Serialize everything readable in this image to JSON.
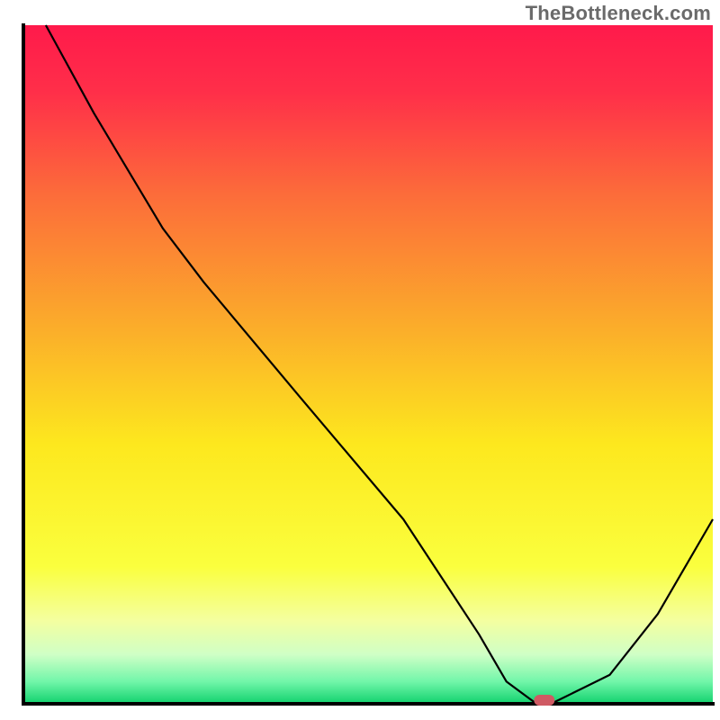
{
  "watermark": "TheBottleneck.com",
  "chart_data": {
    "type": "line",
    "title": "",
    "xlabel": "",
    "ylabel": "",
    "xlim": [
      0,
      100
    ],
    "ylim": [
      0,
      100
    ],
    "series": [
      {
        "name": "bottleneck-curve",
        "x": [
          3,
          10,
          20,
          26,
          40,
          55,
          66,
          70,
          74,
          77,
          85,
          92,
          100
        ],
        "y": [
          100,
          87,
          70,
          62,
          45,
          27,
          10,
          3,
          0,
          0,
          4,
          13,
          27
        ]
      }
    ],
    "marker": {
      "name": "optimal-range",
      "x_start": 74,
      "x_end": 77,
      "y": 0,
      "color": "#cf5a63"
    },
    "background_gradient": {
      "stops": [
        {
          "offset": 0.0,
          "color": "#ff1a4b"
        },
        {
          "offset": 0.1,
          "color": "#ff2f49"
        },
        {
          "offset": 0.25,
          "color": "#fc6c3a"
        },
        {
          "offset": 0.45,
          "color": "#fbae2a"
        },
        {
          "offset": 0.62,
          "color": "#fde81e"
        },
        {
          "offset": 0.8,
          "color": "#faff3e"
        },
        {
          "offset": 0.88,
          "color": "#f4ffa0"
        },
        {
          "offset": 0.93,
          "color": "#cfffc6"
        },
        {
          "offset": 0.97,
          "color": "#71f6a9"
        },
        {
          "offset": 1.0,
          "color": "#18d472"
        }
      ]
    },
    "axis_color": "#000000",
    "axis_width": 4,
    "curve_color": "#000000",
    "curve_width": 2.2
  }
}
